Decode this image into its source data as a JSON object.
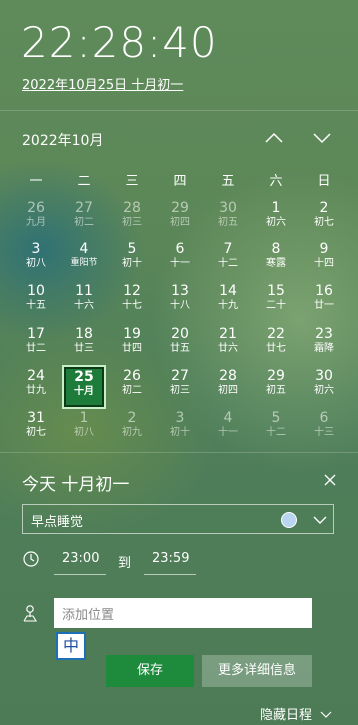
{
  "header": {
    "time": "22:28:40",
    "date_link": "2022年10月25日 十月初一"
  },
  "calendar": {
    "month_title": "2022年10月",
    "weekdays": [
      "一",
      "二",
      "三",
      "四",
      "五",
      "六",
      "日"
    ],
    "weeks": [
      [
        {
          "d": "26",
          "l": "九月",
          "other": true
        },
        {
          "d": "27",
          "l": "初二",
          "other": true
        },
        {
          "d": "28",
          "l": "初三",
          "other": true
        },
        {
          "d": "29",
          "l": "初四",
          "other": true
        },
        {
          "d": "30",
          "l": "初五",
          "other": true
        },
        {
          "d": "1",
          "l": "初六"
        },
        {
          "d": "2",
          "l": "初七"
        }
      ],
      [
        {
          "d": "3",
          "l": "初八"
        },
        {
          "d": "4",
          "l": "重阳节"
        },
        {
          "d": "5",
          "l": "初十"
        },
        {
          "d": "6",
          "l": "十一"
        },
        {
          "d": "7",
          "l": "十二"
        },
        {
          "d": "8",
          "l": "寒露"
        },
        {
          "d": "9",
          "l": "十四"
        }
      ],
      [
        {
          "d": "10",
          "l": "十五"
        },
        {
          "d": "11",
          "l": "十六"
        },
        {
          "d": "12",
          "l": "十七"
        },
        {
          "d": "13",
          "l": "十八"
        },
        {
          "d": "14",
          "l": "十九"
        },
        {
          "d": "15",
          "l": "二十"
        },
        {
          "d": "16",
          "l": "廿一"
        }
      ],
      [
        {
          "d": "17",
          "l": "廿二"
        },
        {
          "d": "18",
          "l": "廿三"
        },
        {
          "d": "19",
          "l": "廿四"
        },
        {
          "d": "20",
          "l": "廿五"
        },
        {
          "d": "21",
          "l": "廿六"
        },
        {
          "d": "22",
          "l": "廿七"
        },
        {
          "d": "23",
          "l": "霜降"
        }
      ],
      [
        {
          "d": "24",
          "l": "廿九"
        },
        {
          "d": "25",
          "l": "十月",
          "today": true
        },
        {
          "d": "26",
          "l": "初二"
        },
        {
          "d": "27",
          "l": "初三"
        },
        {
          "d": "28",
          "l": "初四"
        },
        {
          "d": "29",
          "l": "初五"
        },
        {
          "d": "30",
          "l": "初六"
        }
      ],
      [
        {
          "d": "31",
          "l": "初七"
        },
        {
          "d": "1",
          "l": "初八",
          "other": true
        },
        {
          "d": "2",
          "l": "初九",
          "other": true
        },
        {
          "d": "3",
          "l": "初十",
          "other": true
        },
        {
          "d": "4",
          "l": "十一",
          "other": true
        },
        {
          "d": "5",
          "l": "十二",
          "other": true
        },
        {
          "d": "6",
          "l": "十三",
          "other": true
        }
      ]
    ]
  },
  "agenda": {
    "title": "今天 十月初一",
    "event_title": "早点睡觉",
    "event_color": "#b9d5f2",
    "start_time": "23:00",
    "to_label": "到",
    "end_time": "23:59",
    "location_placeholder": "添加位置",
    "ime_indicator": "中",
    "save_label": "保存",
    "more_label": "更多详细信息",
    "hide_label": "隐藏日程"
  }
}
